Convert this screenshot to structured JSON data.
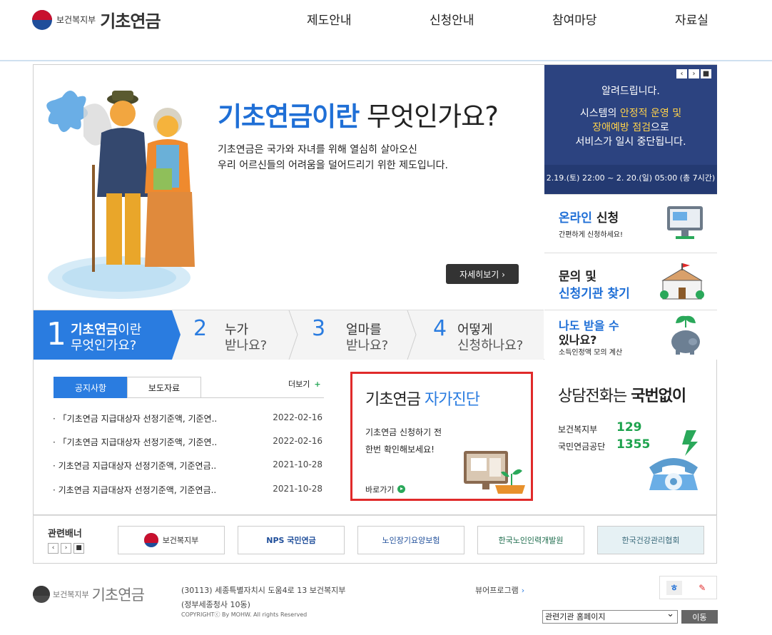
{
  "header": {
    "ministry": "보건복지부",
    "brand": "기초연금",
    "nav": [
      "제도안내",
      "신청안내",
      "참여마당",
      "자료실"
    ]
  },
  "hero": {
    "title_blue": "기초연금이란",
    "title_rest": " 무엇인가요?",
    "desc_line1": "기초연금은 국가와 자녀를 위해 열심히 살아오신",
    "desc_line2": "우리 어르신들의 어려움을 덜어드리기 위한 제도입니다.",
    "more_button": "자세히보기  ›"
  },
  "steps": [
    {
      "num": "1",
      "l1a": "기초연금",
      "l1b": "이란",
      "l2": "무엇인가요?"
    },
    {
      "num": "2",
      "l1": "누가",
      "l2": "받나요?"
    },
    {
      "num": "3",
      "l1": "얼마를",
      "l2": "받나요?"
    },
    {
      "num": "4",
      "l1": "어떻게",
      "l2": "신청하나요?"
    }
  ],
  "notice": {
    "controls": [
      "‹",
      "›",
      "■"
    ],
    "title": "알려드립니다.",
    "line1_a": "시스템의 ",
    "line1_b": "안정적 운영 및",
    "line2_a": "장애예방 점검",
    "line2_b": "으로",
    "line3": "서비스가 일시 중단됩니다.",
    "schedule": "2.19.(토) 22:00 ~ 2. 20.(일) 05:00 (총 7시간)"
  },
  "side": {
    "online_a": "온라인",
    "online_b": " 신청",
    "online_sub": "간편하게 신청하세요!",
    "inquiry_l1": "문의 및",
    "inquiry_l2": "신청기관 찾기",
    "eligible_l1": "나도 받을 수",
    "eligible_l2": "있나요?",
    "eligible_sub": "소득인정액 모의 계산"
  },
  "board": {
    "tabs": [
      "공지사항",
      "보도자료"
    ],
    "more": "더보기",
    "more_icon": "+",
    "items": [
      {
        "title": "「기초연금 지급대상자 선정기준액, 기준연..",
        "date": "2022-02-16"
      },
      {
        "title": "「기초연금 지급대상자 선정기준액, 기준연..",
        "date": "2022-02-16"
      },
      {
        "title": " 기초연금 지급대상자 선정기준액, 기준연금..",
        "date": "2021-10-28"
      },
      {
        "title": " 기초연금 지급대상자 선정기준액, 기준연금..",
        "date": "2021-10-28"
      }
    ]
  },
  "selfcheck": {
    "title_a": "기초연금 ",
    "title_b": "자가진단",
    "desc1": "기초연금 신청하기 전",
    "desc2": "한번 확인해보세요!",
    "go": "바로가기"
  },
  "phone": {
    "title_a": "상담전화는 ",
    "title_b": "국번없이",
    "rows": [
      {
        "label": "보건복지부",
        "num": "129"
      },
      {
        "label": "국민연금공단",
        "num": "1355"
      }
    ]
  },
  "banners": {
    "label": "관련배너",
    "controls": [
      "‹",
      "›",
      "■"
    ],
    "items": [
      "보건복지부",
      "NPS 국민연금",
      "노인장기요양보험",
      "한국노인인력개발원",
      "한국건강관리협회"
    ]
  },
  "footer": {
    "ministry": "보건복지부",
    "brand": "기초연금",
    "address": "(30113) 세종특별자치시 도움4로 13 보건복지부",
    "address2": "(정부세종청사 10동)",
    "copyright": "COPYRIGHTⓒ By MOHW. All rights Reserved",
    "viewer": "뷰어프로그램",
    "select": "관련기관 홈페이지",
    "go": "이동"
  },
  "colors": {
    "accent": "#2a7ce0",
    "navy": "#2c4380",
    "green": "#1ea34e",
    "red": "#e02a2a"
  }
}
